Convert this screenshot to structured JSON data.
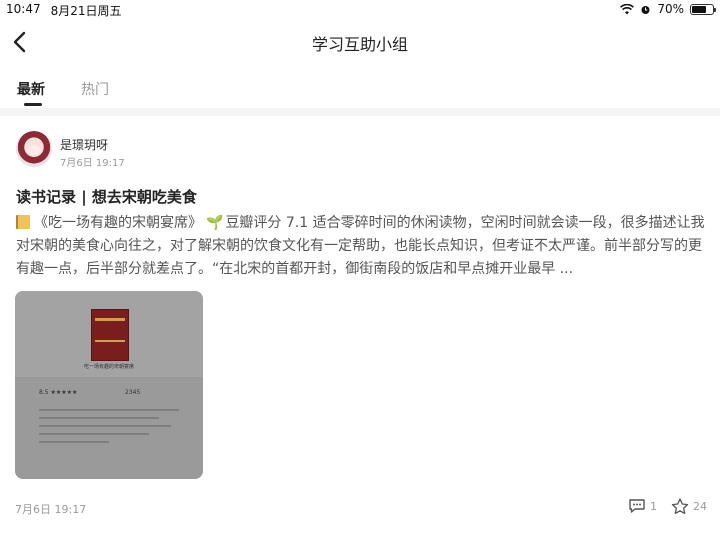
{
  "status_bar": {
    "time": "10:47",
    "date": "8月21日周五",
    "battery": "70%",
    "battery_level": 0.7,
    "icons": [
      "wifi-icon",
      "alarm-icon",
      "battery-icon"
    ]
  },
  "nav": {
    "title": "学习互助小组",
    "back_icon": "chevron-left-icon"
  },
  "tabs": [
    {
      "label": "最新",
      "active": true
    },
    {
      "label": "热门",
      "active": false
    }
  ],
  "post": {
    "username": "是璟玥呀",
    "time": "7月6日 19:17",
    "title": "读书记录 | 想去宋朝吃美食",
    "body_part1": "《吃一场有趣的宋朝宴席》",
    "body_part2": "豆瓣评分 7.1 适合零碎时间的休闲读物，空闲时间就会读一段，很多描述让我对宋朝的美食心向往之，对了解宋朝的饮食文化有一定帮助，也能长点知识，但考证不太严谨。前半部分写的更有趣一点，后半部分就差点了。“在北宋的首都开封，御街南段的饭店和早点摊开业最早 ...",
    "image": {
      "book_title": "吃一场有趣的宋朝宴席",
      "rating": "8.5 ★★★★★",
      "count": "2345"
    },
    "footer_time": "7月6日 19:17",
    "comments": "1",
    "likes": "24"
  },
  "colors": {
    "accent": "#222222",
    "muted": "#9b9b9b",
    "divider": "#f4f4f4",
    "card_bg": "#9a9a9a"
  }
}
